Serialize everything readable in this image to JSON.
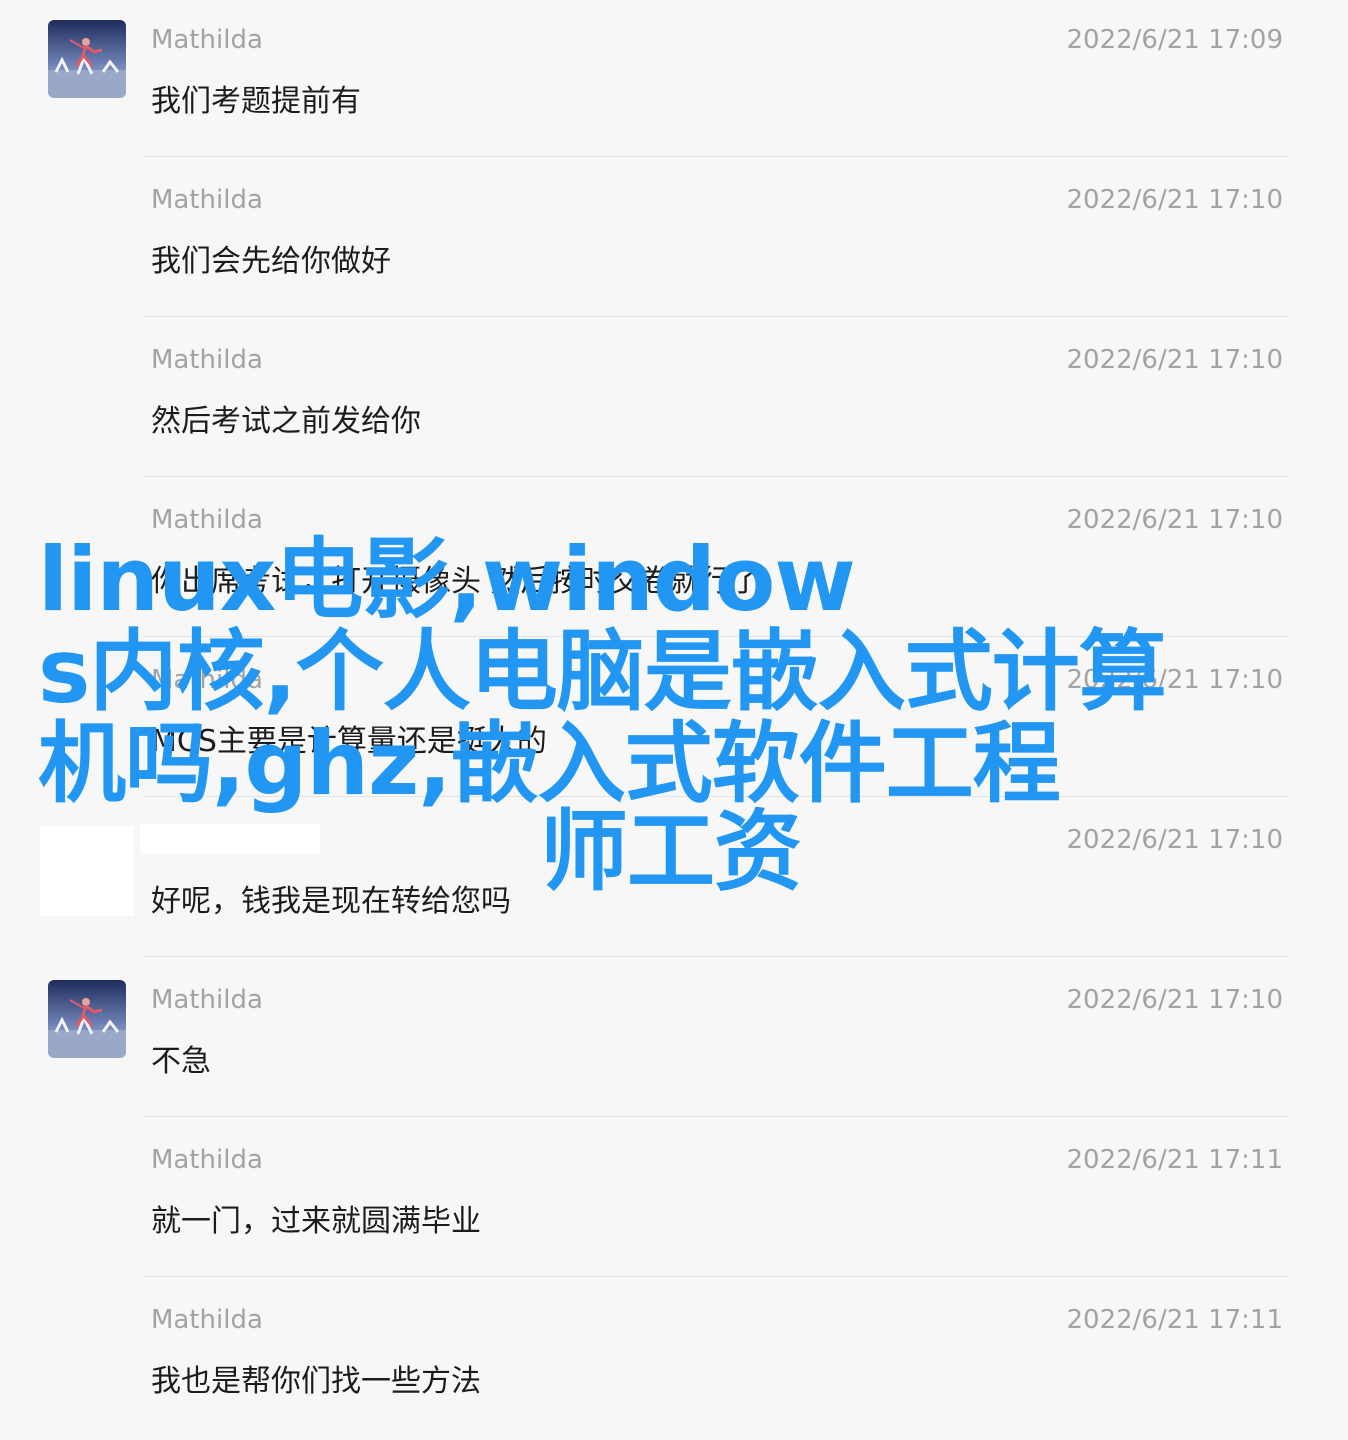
{
  "messages": [
    {
      "sender": "Mathilda",
      "time": "2022/6/21 17:09",
      "text": "我们考题提前有",
      "avatar": true
    },
    {
      "sender": "Mathilda",
      "time": "2022/6/21 17:10",
      "text": "我们会先给你做好",
      "avatar": false
    },
    {
      "sender": "Mathilda",
      "time": "2022/6/21 17:10",
      "text": "然后考试之前发给你",
      "avatar": false
    },
    {
      "sender": "Mathilda",
      "time": "2022/6/21 17:10",
      "text": "你出席考试，打开摄像头 然后按时交卷就行了",
      "avatar": false
    },
    {
      "sender": "Mathilda",
      "time": "2022/6/21 17:10",
      "text": "MCS主要是计算量还是挺大的",
      "avatar": false
    },
    {
      "sender": "",
      "time": "2022/6/21 17:10",
      "text": "好呢，钱我是现在转给您吗",
      "avatar": false
    },
    {
      "sender": "Mathilda",
      "time": "2022/6/21 17:10",
      "text": "不急",
      "avatar": true
    },
    {
      "sender": "Mathilda",
      "time": "2022/6/21 17:11",
      "text": "就一门，过来就圆满毕业",
      "avatar": false
    },
    {
      "sender": "Mathilda",
      "time": "2022/6/21 17:11",
      "text": "我也是帮你们找一些方法",
      "avatar": false
    }
  ],
  "overlay": {
    "lines": [
      "linux电影,window",
      "s内核,个人电脑是嵌入式计算",
      "机吗,ghz,嵌入式软件工程",
      "师工资"
    ],
    "color": "#2196f3"
  },
  "avatar_icon": "dancer-photo-icon"
}
